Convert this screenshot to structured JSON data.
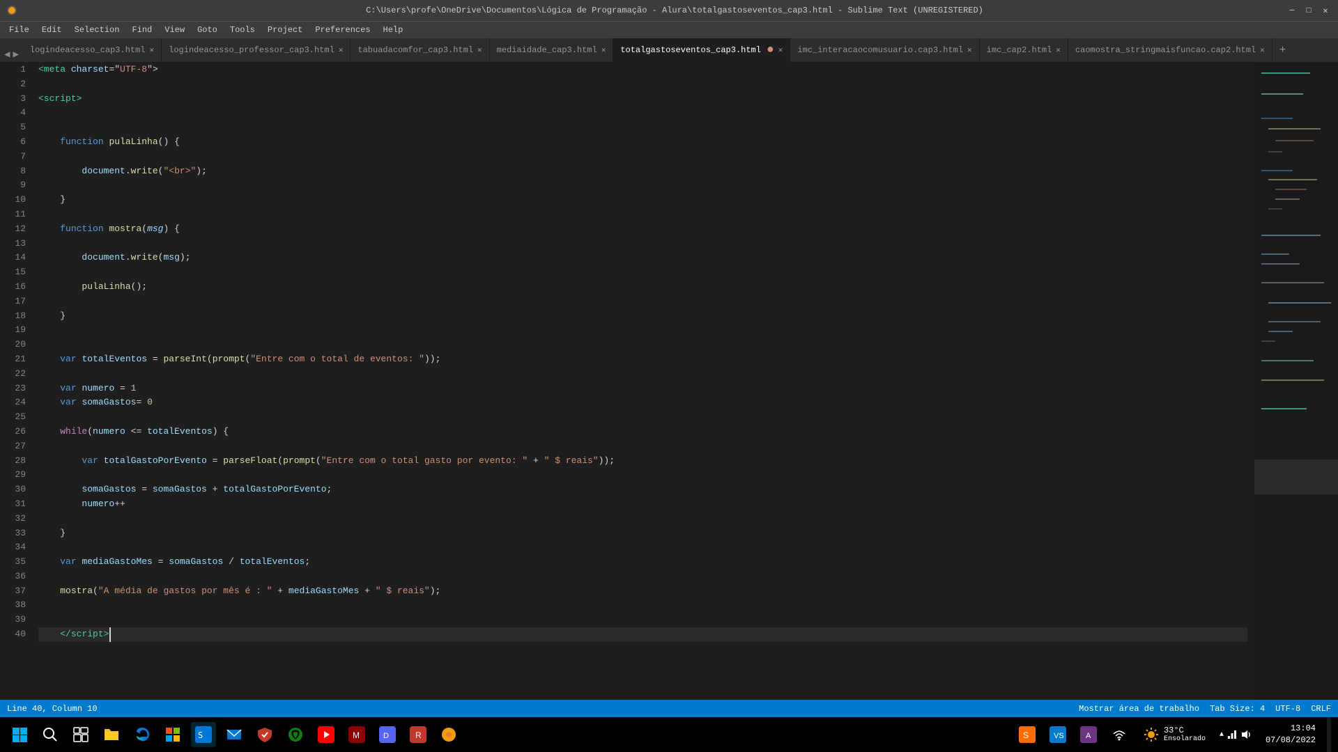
{
  "titleBar": {
    "text": "C:\\Users\\profe\\OneDrive\\Documentos\\Lógica de Programação - Alura\\totalgastoseventos_cap3.html - Sublime Text (UNREGISTERED)",
    "minimize": "─",
    "maximize": "□",
    "close": "✕"
  },
  "menuBar": {
    "items": [
      "File",
      "Edit",
      "Selection",
      "Find",
      "View",
      "Goto",
      "Tools",
      "Project",
      "Preferences",
      "Help"
    ]
  },
  "tabs": [
    {
      "label": "logindeacesso_cap3.html",
      "active": false,
      "modified": false
    },
    {
      "label": "logindeacesso_professor_cap3.html",
      "active": false,
      "modified": false
    },
    {
      "label": "tabuadacomfor_cap3.html",
      "active": false,
      "modified": false
    },
    {
      "label": "mediaidade_cap3.html",
      "active": false,
      "modified": false
    },
    {
      "label": "totalgastoseventos_cap3.html",
      "active": true,
      "modified": true
    },
    {
      "label": "imc_interacaocomusuario.cap3.html",
      "active": false,
      "modified": false
    },
    {
      "label": "imc_cap2.html",
      "active": false,
      "modified": false
    },
    {
      "label": "caomostra_stringmaisfuncao.cap2.html",
      "active": false,
      "modified": false
    }
  ],
  "statusBar": {
    "left": "Line 40, Column 10",
    "right_label": "Mostrar área de trabalho",
    "tab_size": "Tab Size: 4",
    "encoding": "UTF-8",
    "eol": "CRLF"
  },
  "taskbar": {
    "weather": "33°C",
    "weather_desc": "Ensolarado",
    "time": "13:04",
    "date": "07/08/2022"
  },
  "lineNumbers": [
    1,
    2,
    3,
    4,
    5,
    6,
    7,
    8,
    9,
    10,
    11,
    12,
    13,
    14,
    15,
    16,
    17,
    18,
    19,
    20,
    21,
    22,
    23,
    24,
    25,
    26,
    27,
    28,
    29,
    30,
    31,
    32,
    33,
    34,
    35,
    36,
    37,
    38,
    39,
    40
  ]
}
